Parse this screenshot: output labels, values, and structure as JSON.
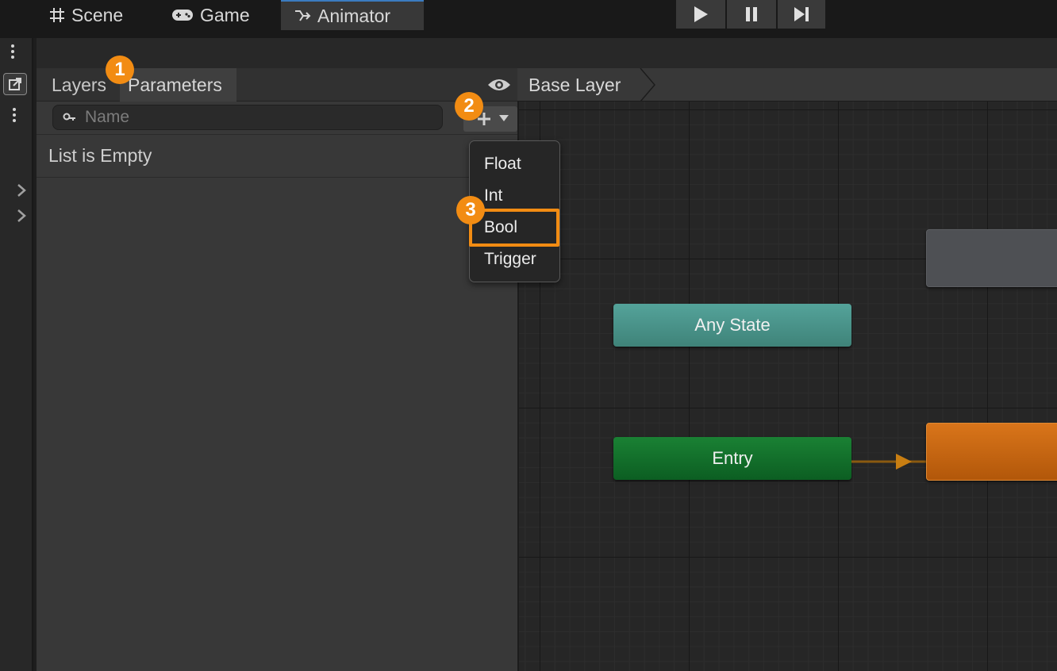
{
  "toolbar": {
    "play": "play-icon",
    "pause": "pause-icon",
    "step": "step-icon"
  },
  "window_tabs": [
    {
      "label": "Scene",
      "icon": "grid-icon"
    },
    {
      "label": "Game",
      "icon": "gamepad-icon"
    },
    {
      "label": "Animator",
      "icon": "animator-icon",
      "active": true
    }
  ],
  "animator": {
    "subtabs": {
      "layers": "Layers",
      "parameters": "Parameters"
    },
    "search": {
      "placeholder": "Name"
    },
    "empty_text": "List is Empty",
    "breadcrumb": "Base Layer",
    "menu": {
      "items": [
        "Float",
        "Int",
        "Bool",
        "Trigger"
      ],
      "highlighted": "Bool"
    }
  },
  "graph": {
    "nodes": {
      "any_state": "Any State",
      "entry": "Entry"
    },
    "colors": {
      "any_state": "#4b948b",
      "entry": "#116e2b",
      "default_state": "#c8640f",
      "state": "#4e5054"
    }
  },
  "badges": {
    "b1": "1",
    "b2": "2",
    "b3": "3"
  },
  "accent": "#f28c13"
}
